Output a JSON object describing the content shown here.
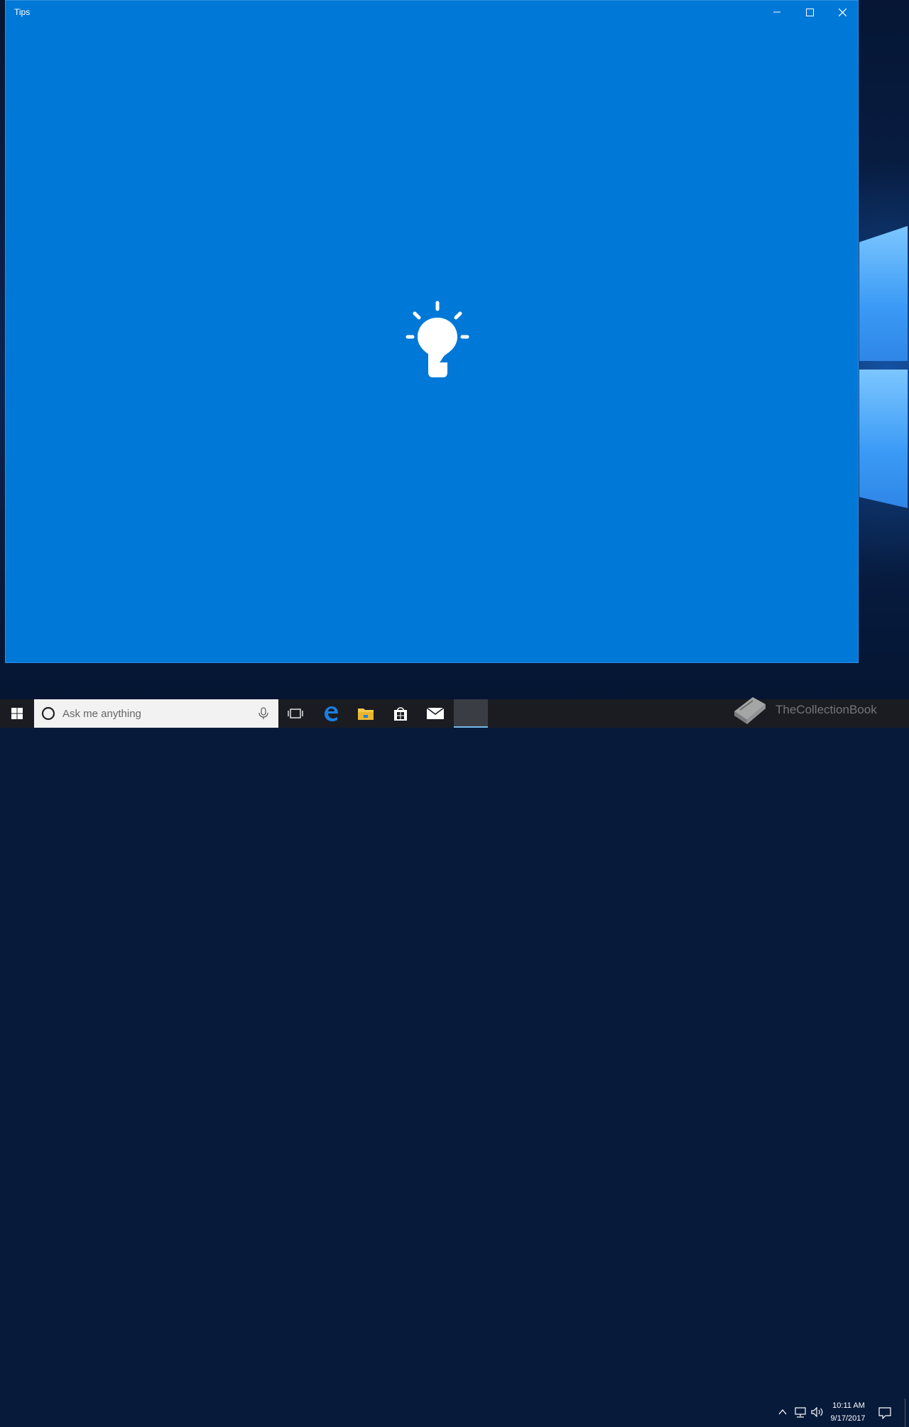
{
  "window": {
    "title": "Tips",
    "background_color": "#0078d7",
    "controls": {
      "minimize": "minimize-icon",
      "maximize": "maximize-icon",
      "close": "close-icon"
    },
    "splash_icon": "lightbulb-icon"
  },
  "taskbar": {
    "start_icon": "windows-logo-icon",
    "search": {
      "placeholder": "Ask me anything",
      "left_icon": "cortana-circle-icon",
      "right_icon": "microphone-icon"
    },
    "pinned": [
      {
        "name": "task-view",
        "icon": "task-view-icon"
      },
      {
        "name": "edge",
        "icon": "edge-icon"
      },
      {
        "name": "file-explorer",
        "icon": "folder-icon"
      },
      {
        "name": "store",
        "icon": "store-icon"
      },
      {
        "name": "mail",
        "icon": "mail-icon"
      },
      {
        "name": "tips",
        "icon": "tips-app-icon",
        "active": true
      }
    ],
    "tray": {
      "icons": [
        "chevron-up-icon",
        "network-icon",
        "volume-icon"
      ],
      "time": "10:11 AM",
      "date": "9/17/2017",
      "action_center_icon": "action-center-icon"
    },
    "accent_color": "#76b9ed"
  },
  "watermark": {
    "text": "TheCollectionBook",
    "icon": "book-icon"
  }
}
